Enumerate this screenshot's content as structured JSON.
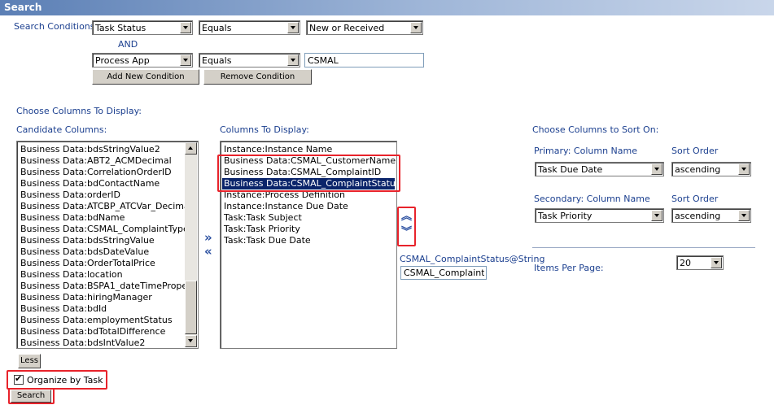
{
  "window": {
    "title": "Search"
  },
  "conditions": {
    "label": "Search Conditions:",
    "and_label": "AND",
    "row1": {
      "field": "Task Status",
      "operator": "Equals",
      "value": "New or Received"
    },
    "row2": {
      "field": "Process App",
      "operator": "Equals",
      "value": "CSMAL"
    },
    "add_button": "Add New Condition",
    "remove_button": "Remove Condition"
  },
  "columns": {
    "section_label": "Choose Columns To Display:",
    "candidate_label": "Candidate Columns:",
    "display_label": "Columns To Display:",
    "candidate_items": [
      "Business Data:bdsStringValue2",
      "Business Data:ABT2_ACMDecimal",
      "Business Data:CorrelationOrderID",
      "Business Data:bdContactName",
      "Business Data:orderID",
      "Business Data:ATCBP_ATCVar_Decimal",
      "Business Data:bdName",
      "Business Data:CSMAL_ComplaintType",
      "Business Data:bdsStringValue",
      "Business Data:bdsDateValue",
      "Business Data:OrderTotalPrice",
      "Business Data:location",
      "Business Data:BSPA1_dateTimePrope",
      "Business Data:hiringManager",
      "Business Data:bdId",
      "Business Data:employmentStatus",
      "Business Data:bdTotalDifference",
      "Business Data:bdsIntValue2"
    ],
    "display_items": [
      "Instance:Instance Name",
      "Business Data:CSMAL_CustomerName",
      "Business Data:CSMAL_ComplaintID",
      "Business Data:CSMAL_ComplaintStatus",
      "Instance:Process Definition",
      "Instance:Instance Due Date",
      "Task:Task Subject",
      "Task:Task Priority",
      "Task:Task Due Date"
    ],
    "selected_display_item": "Business Data:CSMAL_ComplaintStatus",
    "move_right_glyph": "»",
    "move_left_glyph": "«",
    "move_up_glyph": "︽",
    "move_down_glyph": "︾",
    "alias_label": "CSMAL_ComplaintStatus@String",
    "alias_value": "CSMAL_ComplaintSta",
    "less_button": "Less"
  },
  "sort": {
    "section_label": "Choose Columns to Sort On:",
    "primary_label": "Primary: Column Name",
    "primary_order_label": "Sort Order",
    "primary_column": "Task Due Date",
    "primary_order": "ascending",
    "secondary_label": "Secondary: Column Name",
    "secondary_order_label": "Sort Order",
    "secondary_column": "Task Priority",
    "secondary_order": "ascending",
    "items_per_page_label": "Items Per Page:",
    "items_per_page": "20"
  },
  "options": {
    "organize_by_task_label": "Organize by Task",
    "organize_by_task_checked": true,
    "search_button": "Search"
  },
  "colors": {
    "highlight_box": "#e8232b",
    "selection": "#0a246a",
    "label_blue": "#1b3f8f"
  }
}
